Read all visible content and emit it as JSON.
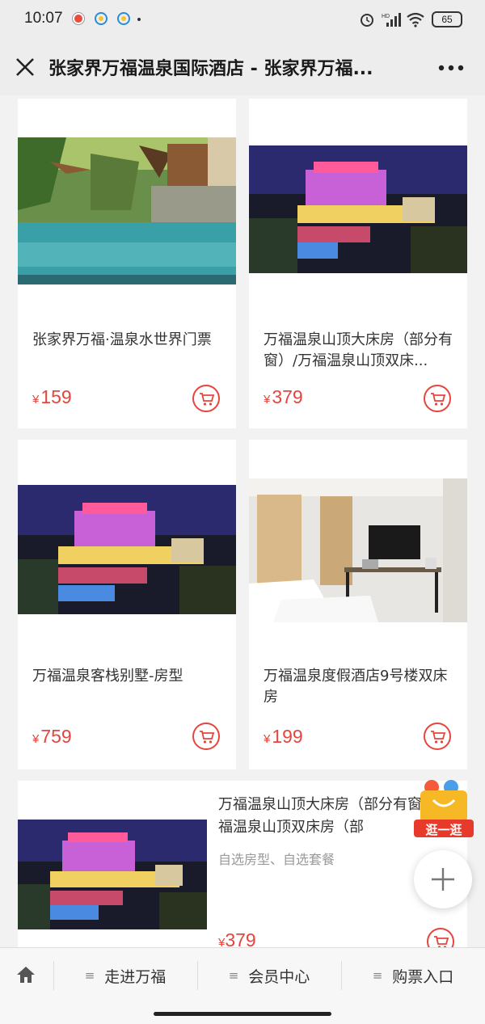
{
  "status_bar": {
    "time": "10:07",
    "battery": "65"
  },
  "nav": {
    "title": "张家界万福温泉国际酒店 - 张家界万福..."
  },
  "products": [
    {
      "title": "张家界万福·温泉水世界门票",
      "currency": "¥",
      "price": "159"
    },
    {
      "title": "万福温泉山顶大床房（部分有窗）/万福温泉山顶双床...",
      "currency": "¥",
      "price": "379"
    },
    {
      "title": "万福温泉客栈别墅-房型",
      "currency": "¥",
      "price": "759"
    },
    {
      "title": "万福温泉度假酒店9号楼双床房",
      "currency": "¥",
      "price": "199"
    }
  ],
  "wide_product": {
    "title": "万福温泉山顶大床房（部分有窗）/万福温泉山顶双床房（部",
    "subtitle": "自选房型、自选套餐",
    "currency": "¥",
    "price": "379"
  },
  "floating": {
    "shop_label": "逛一逛"
  },
  "bottom_menu": {
    "items": [
      "走进万福",
      "会员中心",
      "购票入口"
    ]
  },
  "colors": {
    "price": "#e5453d",
    "accent": "#e5453d"
  }
}
